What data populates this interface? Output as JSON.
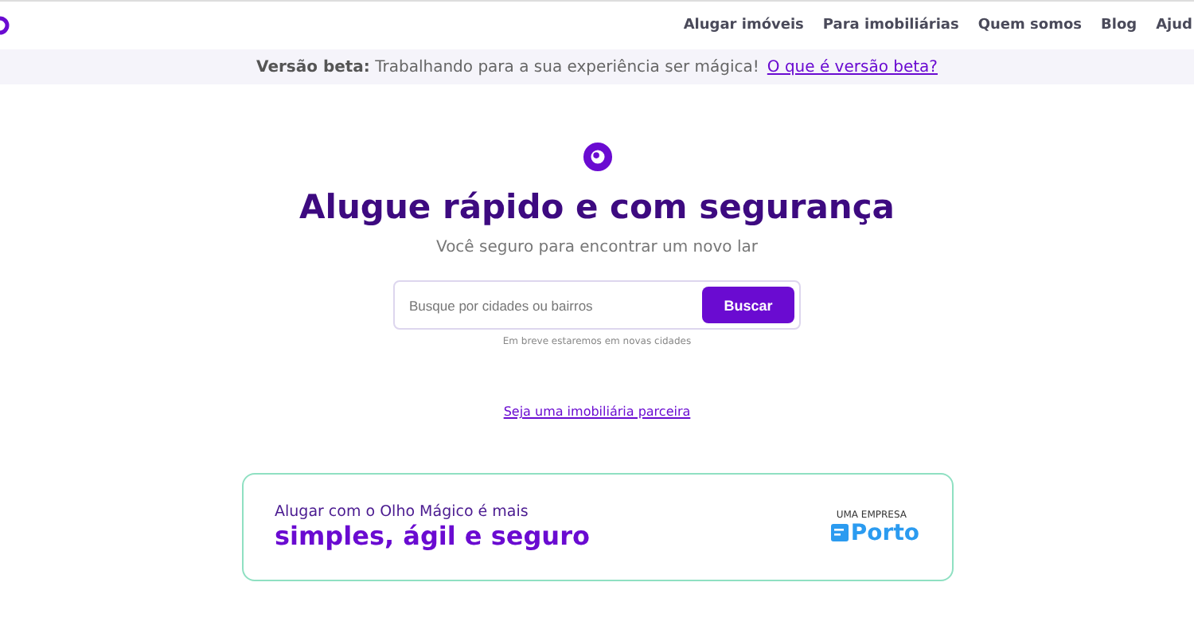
{
  "nav": {
    "items": [
      "Alugar imóveis",
      "Para imobiliárias",
      "Quem somos",
      "Blog",
      "Ajud"
    ]
  },
  "beta_bar": {
    "label": "Versão beta:",
    "message": "Trabalhando para a sua experiência ser mágica!",
    "link": "O que é versão beta?"
  },
  "hero": {
    "title": "Alugue rápido e com segurança",
    "subtitle": "Você seguro para encontrar um novo lar",
    "search": {
      "placeholder": "Busque por cidades ou bairros",
      "button": "Buscar"
    },
    "note": "Em breve estaremos em novas cidades",
    "partner_link": "Seja uma imobiliária parceira"
  },
  "promo": {
    "line_1": "Alugar com o Olho Mágico é mais",
    "line_2": "simples, ágil e seguro",
    "partner_tag": "UMA EMPRESA",
    "partner_name": "Porto"
  }
}
